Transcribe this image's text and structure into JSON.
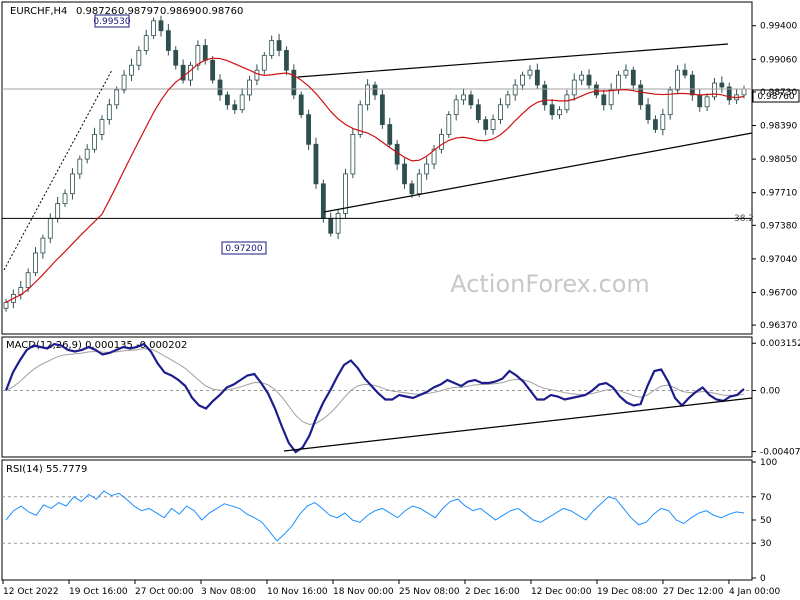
{
  "chart_data": [
    {
      "type": "candlestick",
      "title": "EURCHF,H4",
      "ohlc_readout": [
        "0.98726",
        "0.98797",
        "0.98690",
        "0.98760"
      ],
      "last_price": "0.98760",
      "watermark": "ActionForex.com",
      "ylim": [
        0.963,
        0.9962
      ],
      "y_ticks": [
        "0.99400",
        "0.99060",
        "0.98730",
        "0.98390",
        "0.98050",
        "0.97710",
        "0.97380",
        "0.97040",
        "0.96700",
        "0.96370"
      ],
      "x_ticks": [
        "12 Oct 2022",
        "19 Oct 16:00",
        "27 Oct 00:00",
        "3 Nov 08:00",
        "10 Nov 16:00",
        "18 Nov 00:00",
        "25 Nov 08:00",
        "2 Dec 16:00",
        "12 Dec 00:00",
        "19 Dec 08:00",
        "27 Dec 12:00",
        "4 Jan 00:00"
      ],
      "annotations": {
        "swing_high": "0.99530",
        "swing_low": "0.97200",
        "fib_label": "38.2",
        "fib_level": 0.9745
      },
      "closes": [
        0.966,
        0.9668,
        0.9675,
        0.969,
        0.971,
        0.9725,
        0.9745,
        0.976,
        0.977,
        0.979,
        0.9805,
        0.9815,
        0.983,
        0.9845,
        0.986,
        0.9875,
        0.989,
        0.99,
        0.9915,
        0.993,
        0.9945,
        0.9935,
        0.9915,
        0.99,
        0.9885,
        0.99,
        0.992,
        0.9905,
        0.9885,
        0.987,
        0.986,
        0.9855,
        0.987,
        0.9885,
        0.9895,
        0.991,
        0.9925,
        0.9915,
        0.9895,
        0.987,
        0.985,
        0.982,
        0.978,
        0.9745,
        0.973,
        0.975,
        0.979,
        0.983,
        0.986,
        0.988,
        0.987,
        0.984,
        0.982,
        0.98,
        0.978,
        0.977,
        0.979,
        0.98,
        0.9815,
        0.983,
        0.985,
        0.9865,
        0.987,
        0.986,
        0.9845,
        0.9835,
        0.9845,
        0.986,
        0.987,
        0.988,
        0.989,
        0.9895,
        0.988,
        0.986,
        0.985,
        0.9855,
        0.987,
        0.9885,
        0.989,
        0.988,
        0.987,
        0.986,
        0.9875,
        0.989,
        0.9895,
        0.988,
        0.986,
        0.9845,
        0.9835,
        0.985,
        0.9875,
        0.9895,
        0.989,
        0.987,
        0.9858,
        0.9868,
        0.9882,
        0.9878,
        0.9865,
        0.987,
        0.9876
      ],
      "ma_label": "red moving average"
    },
    {
      "type": "line",
      "title": "MACD(12,26,9) 0.000135 -0.000202",
      "ylim": [
        -0.0043,
        0.0033
      ],
      "y_ticks": [
        "0.003152",
        "0.00",
        "-0.004073"
      ],
      "zero_label": "0.00",
      "macd": [
        0.0,
        0.0012,
        0.002,
        0.0027,
        0.003,
        0.0029,
        0.0028,
        0.0031,
        0.003,
        0.0027,
        0.0026,
        0.0027,
        0.0029,
        0.0027,
        0.0024,
        0.0025,
        0.0027,
        0.0029,
        0.0028,
        0.0029,
        0.0031,
        0.0026,
        0.0018,
        0.0012,
        0.001,
        0.0007,
        0.0003,
        -0.0005,
        -0.001,
        -0.0012,
        -0.0007,
        -0.0003,
        0.0002,
        0.0004,
        0.0007,
        0.001,
        0.0011,
        0.0005,
        -0.0002,
        -0.0012,
        -0.0024,
        -0.0035,
        -0.0041,
        -0.0038,
        -0.003,
        -0.0018,
        -0.0008,
        0.0,
        0.0009,
        0.0017,
        0.002,
        0.0015,
        0.0008,
        0.0003,
        -0.0002,
        -0.0006,
        -0.0006,
        -0.0003,
        -0.0004,
        -0.0005,
        -0.0003,
        -0.0001,
        0.0002,
        0.0004,
        0.0007,
        0.0005,
        0.0003,
        0.0006,
        0.0007,
        0.0005,
        0.0005,
        0.0006,
        0.0008,
        0.0013,
        0.001,
        0.0006,
        0.0,
        -0.0006,
        -0.0006,
        -0.0003,
        -0.0004,
        -0.0006,
        -0.0005,
        -0.0004,
        -0.0003,
        0.0,
        0.0004,
        0.0005,
        0.0002,
        -0.0004,
        -0.0008,
        -0.001,
        -0.0009,
        0.0003,
        0.0013,
        0.0014,
        0.0006,
        -0.0005,
        -0.001,
        -0.0005,
        -0.0001,
        0.0002,
        -0.0003,
        -0.0006,
        -0.0007,
        -0.0004,
        -0.0003,
        0.0001
      ],
      "signal_label": "signal"
    },
    {
      "type": "line",
      "title": "RSI(14) 55.7779",
      "ylim": [
        0,
        100
      ],
      "y_ticks": [
        "100",
        "70",
        "50",
        "30",
        "0"
      ],
      "rsi": [
        50,
        58,
        62,
        57,
        54,
        63,
        60,
        65,
        62,
        70,
        66,
        72,
        68,
        75,
        71,
        73,
        68,
        62,
        58,
        60,
        56,
        52,
        60,
        55,
        62,
        58,
        50,
        56,
        60,
        64,
        62,
        60,
        55,
        52,
        48,
        40,
        32,
        38,
        45,
        55,
        62,
        65,
        60,
        54,
        52,
        56,
        50,
        48,
        54,
        58,
        60,
        56,
        52,
        58,
        62,
        60,
        56,
        52,
        60,
        66,
        68,
        62,
        58,
        60,
        55,
        50,
        54,
        58,
        60,
        55,
        50,
        48,
        52,
        56,
        60,
        58,
        54,
        50,
        58,
        64,
        70,
        68,
        60,
        52,
        46,
        48,
        55,
        60,
        58,
        50,
        47,
        52,
        56,
        58,
        54,
        52,
        55,
        57,
        56
      ]
    }
  ]
}
